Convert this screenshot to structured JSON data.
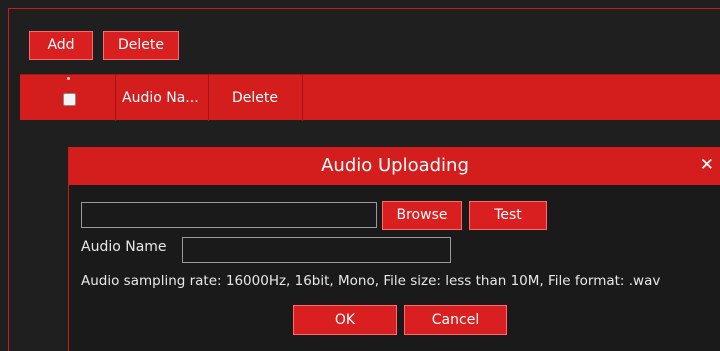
{
  "toolbar": {
    "add_label": "Add",
    "delete_label": "Delete"
  },
  "table": {
    "columns": [
      "",
      "Audio Na...",
      "Delete"
    ],
    "select_all_checked": false
  },
  "dialog": {
    "title": "Audio Uploading",
    "close_label": "✕",
    "file_path_value": "",
    "browse_label": "Browse",
    "test_label": "Test",
    "audio_name_label": "Audio Name",
    "audio_name_value": "",
    "info": "Audio sampling rate: 16000Hz, 16bit, Mono, File size: less than 10M, File format: .wav",
    "ok_label": "OK",
    "cancel_label": "Cancel"
  },
  "colors": {
    "accent": "#d41e1e",
    "background": "#1f1f1f",
    "dialog_bg": "#1a1a1a"
  }
}
